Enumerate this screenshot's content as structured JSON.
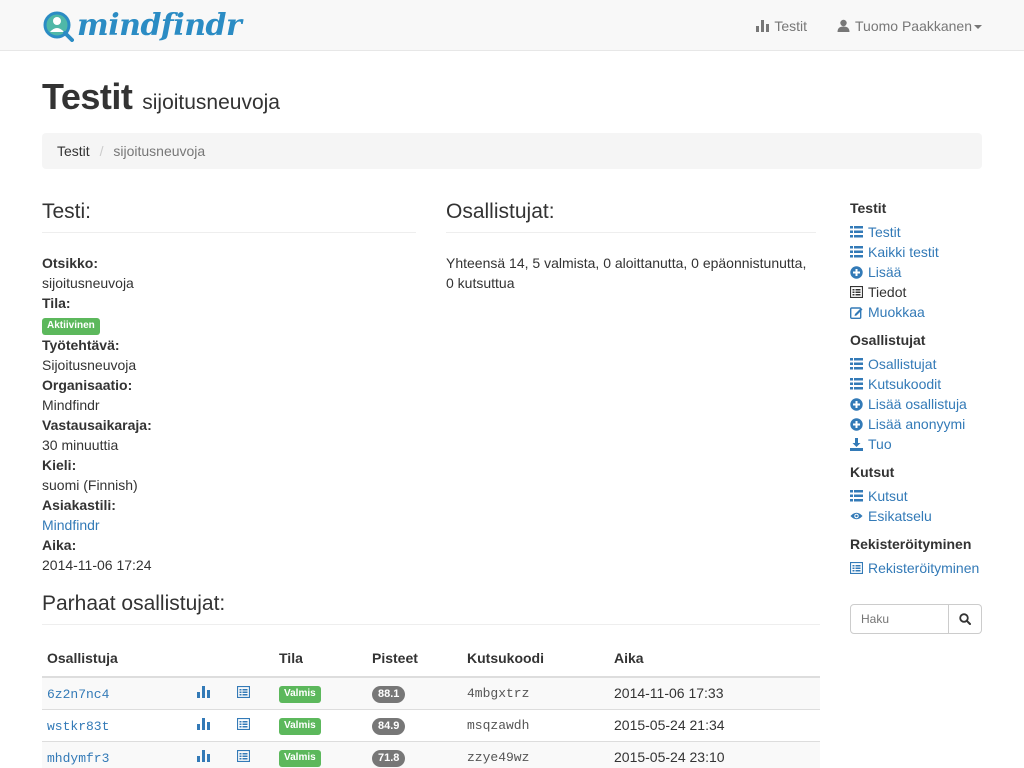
{
  "navbar": {
    "brand": "mindfindr",
    "tests_link": "Testit",
    "user": "Tuomo Paakkanen"
  },
  "header": {
    "title": "Testit",
    "subtitle": "sijoitusneuvoja"
  },
  "breadcrumb": {
    "items": [
      "Testit",
      "sijoitusneuvoja"
    ]
  },
  "test": {
    "heading": "Testi:",
    "fields": [
      {
        "label": "Otsikko:",
        "value": "sijoitusneuvoja"
      },
      {
        "label": "Tila:",
        "value": "Aktiivinen"
      },
      {
        "label": "Työtehtävä:",
        "value": "Sijoitusneuvoja"
      },
      {
        "label": "Organisaatio:",
        "value": "Mindfindr"
      },
      {
        "label": "Vastausaikaraja:",
        "value": "30 minuuttia"
      },
      {
        "label": "Kieli:",
        "value": "suomi (Finnish)"
      },
      {
        "label": "Asiakastili:",
        "value": "Mindfindr"
      },
      {
        "label": "Aika:",
        "value": "2014-11-06 17:24"
      }
    ]
  },
  "participants": {
    "heading": "Osallistujat:",
    "summary": "Yhteensä 14, 5 valmista, 0 aloittanutta, 0 epäonnistunutta, 0 kutsuttua"
  },
  "best": {
    "heading": "Parhaat osallistujat:",
    "columns": [
      "Osallistuja",
      "",
      "",
      "Tila",
      "Pisteet",
      "Kutsukoodi",
      "Aika"
    ],
    "rows": [
      {
        "id": "6z2n7nc4",
        "status": "Valmis",
        "score": "88.1",
        "code": "4mbgxtrz",
        "time": "2014-11-06 17:33"
      },
      {
        "id": "wstkr83t",
        "status": "Valmis",
        "score": "84.9",
        "code": "msqzawdh",
        "time": "2015-05-24 21:34"
      },
      {
        "id": "mhdymfr3",
        "status": "Valmis",
        "score": "71.8",
        "code": "zzye49wz",
        "time": "2015-05-24 23:10"
      }
    ]
  },
  "sidebar": {
    "groups": [
      {
        "title": "Testit",
        "items": [
          {
            "label": "Testit",
            "icon": "list-icon"
          },
          {
            "label": "Kaikki testit",
            "icon": "list-icon"
          },
          {
            "label": "Lisää",
            "icon": "plus-circle-icon"
          },
          {
            "label": "Tiedot",
            "icon": "list-alt-icon"
          },
          {
            "label": "Muokkaa",
            "icon": "edit-icon"
          }
        ]
      },
      {
        "title": "Osallistujat",
        "items": [
          {
            "label": "Osallistujat",
            "icon": "list-icon"
          },
          {
            "label": "Kutsukoodit",
            "icon": "list-icon"
          },
          {
            "label": "Lisää osallistuja",
            "icon": "plus-circle-icon"
          },
          {
            "label": "Lisää anonyymi",
            "icon": "plus-circle-icon"
          },
          {
            "label": "Tuo",
            "icon": "import-icon"
          }
        ]
      },
      {
        "title": "Kutsut",
        "items": [
          {
            "label": "Kutsut",
            "icon": "list-icon"
          },
          {
            "label": "Esikatselu",
            "icon": "eye-icon"
          }
        ]
      },
      {
        "title": "Rekisteröityminen",
        "items": [
          {
            "label": "Rekisteröityminen",
            "icon": "list-alt-icon"
          }
        ]
      }
    ],
    "search_placeholder": "Haku"
  },
  "colors": {
    "link": "#337ab7",
    "brand": "#2b8cc4",
    "success": "#5cb85c",
    "badge": "#777777"
  }
}
